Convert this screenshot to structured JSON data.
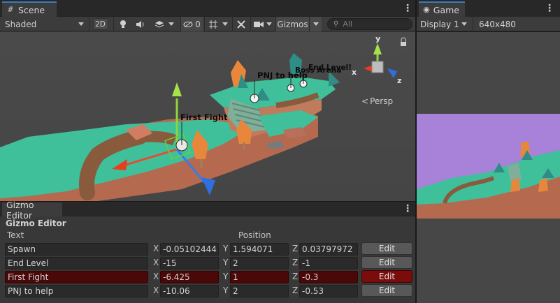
{
  "scene_panel": {
    "tab_label": "Scene",
    "shading_mode": "Shaded",
    "mode_2d": "2D",
    "hidden_count": "0",
    "gizmos_label": "Gizmos",
    "search_placeholder": "All",
    "persp_label": "Persp",
    "axis_labels": {
      "x": "x",
      "y": "y",
      "z": "z"
    },
    "gizmo_labels": [
      "First Fight",
      "PNJ to help",
      "Boss Arena",
      "End Level!"
    ]
  },
  "game_panel": {
    "tab_label": "Game",
    "display": "Display 1",
    "resolution": "640x480"
  },
  "gizmo_editor": {
    "tab_label": "Gizmo Editor",
    "title": "Gizmo Editor",
    "columns": {
      "text": "Text",
      "position": "Position"
    },
    "edit_label": "Edit",
    "rows": [
      {
        "text": "Spawn",
        "x": "-0.05102444",
        "y": "1.594071",
        "z": "0.03797972",
        "selected": false
      },
      {
        "text": "End Level",
        "x": "-15",
        "y": "2",
        "z": "-1",
        "selected": false
      },
      {
        "text": "First Fight",
        "x": "-6.425",
        "y": "1",
        "z": "-0.3",
        "selected": true
      },
      {
        "text": "PNJ to help",
        "x": "-10.06",
        "y": "2",
        "z": "-0.53",
        "selected": false
      }
    ]
  },
  "colors": {
    "sky_game": "#a882d8",
    "terrain_top": "#3fbf9a",
    "terrain_side": "#b86d55",
    "selected_row": "#4a0808",
    "tab_accent": "#3a79bb"
  }
}
